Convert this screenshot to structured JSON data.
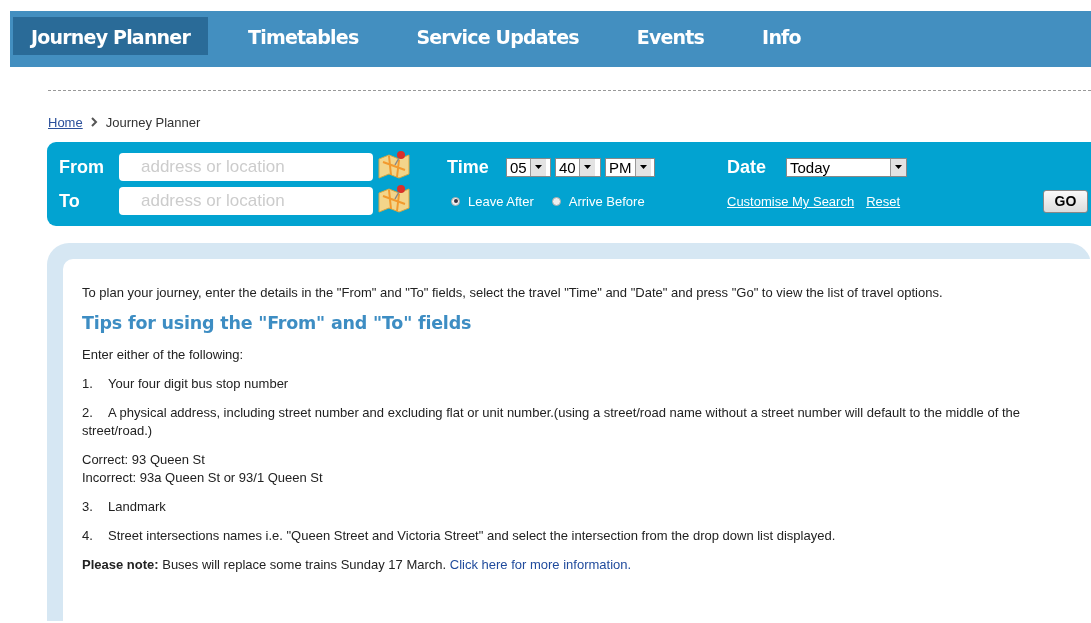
{
  "nav": [
    {
      "label": "Journey Planner",
      "selected": true
    },
    {
      "label": "Timetables",
      "selected": false
    },
    {
      "label": "Service Updates",
      "selected": false
    },
    {
      "label": "Events",
      "selected": false
    },
    {
      "label": "Info",
      "selected": false
    }
  ],
  "breadcrumb": {
    "home": "Home",
    "current": "Journey Planner"
  },
  "planner": {
    "from": {
      "label": "From",
      "placeholder": "address or location"
    },
    "to": {
      "label": "To",
      "placeholder": "address or location"
    },
    "time": {
      "label": "Time",
      "hour": "05",
      "minute": "40",
      "period": "PM"
    },
    "modes": [
      {
        "label": "Leave After",
        "selected": true
      },
      {
        "label": "Arrive Before",
        "selected": false
      }
    ],
    "date": {
      "label": "Date",
      "value": "Today"
    },
    "links": [
      "Customise My Search",
      "Reset"
    ],
    "go": "GO"
  },
  "tips": {
    "intro": "To plan your journey, enter the details in the \"From\" and \"To\" fields, select the travel \"Time\" and \"Date\" and press \"Go\" to view the list of travel options.",
    "heading": "Tips for using the \"From\" and \"To\" fields",
    "lead": "Enter either of the following:",
    "items": [
      {
        "number": "1.",
        "text": "Your four digit bus stop number"
      },
      {
        "number": "2.",
        "text": "A physical address, including street number and excluding flat or unit number.(using a street/road name without a street number will default to the middle of the street/road.)",
        "examples": [
          "Correct: 93 Queen St",
          "Incorrect: 93a Queen St or 93/1 Queen St"
        ]
      },
      {
        "number": "3.",
        "text": "Landmark"
      },
      {
        "number": "4.",
        "text": "Street intersections names i.e. \"Queen Street and Victoria Street\" and select the intersection from the drop down list displayed."
      }
    ],
    "note": "**Please note:** Buses will replace some trains Sunday 17 March.",
    "note_link": "Click here for more information."
  }
}
